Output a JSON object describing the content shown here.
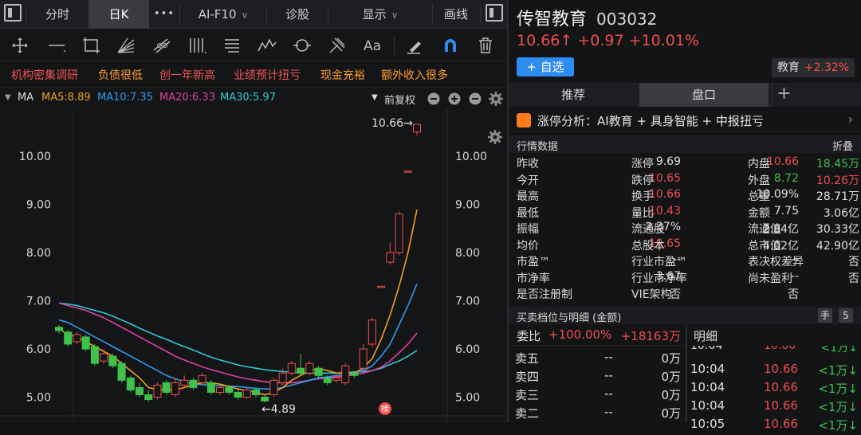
{
  "top_tabs": {
    "fenshi": "分时",
    "rik": "日K",
    "more": "•••",
    "aif10": "AI-F10",
    "zhengu": "诊股",
    "xianshi": "显示",
    "huaxian": "画线"
  },
  "tags": [
    "机构密集调研",
    "负债很低",
    "创一年新高",
    "业绩预计扭亏",
    "现金充裕",
    "额外收入很多"
  ],
  "ma": {
    "label": "MA",
    "ma5": "MA5:8.89",
    "ma10": "MA10:7.35",
    "ma20": "MA20:6.33",
    "ma30": "MA30:5.97",
    "fuquan": "前复权",
    "colors": {
      "ma5": "#f0a020",
      "ma10": "#2f9bf0",
      "ma20": "#e040a0",
      "ma30": "#30c8d8"
    }
  },
  "chart_data": {
    "type": "candlestick",
    "y_ticks": [
      "10.00",
      "9.00",
      "8.00",
      "7.00",
      "6.00",
      "5.00"
    ],
    "ylim": [
      4.7,
      10.9
    ],
    "high_annotation": "10.66→",
    "low_annotation": "←4.89",
    "badge": "榜",
    "candles": [
      {
        "o": 6.45,
        "c": 6.38,
        "h": 6.5,
        "l": 6.32
      },
      {
        "o": 6.35,
        "c": 6.1,
        "h": 6.4,
        "l": 6.05
      },
      {
        "o": 6.15,
        "c": 6.3,
        "h": 6.35,
        "l": 6.1
      },
      {
        "o": 6.25,
        "c": 6.0,
        "h": 6.3,
        "l": 5.95
      },
      {
        "o": 6.05,
        "c": 5.7,
        "h": 6.1,
        "l": 5.65
      },
      {
        "o": 5.75,
        "c": 5.9,
        "h": 6.0,
        "l": 5.7
      },
      {
        "o": 5.85,
        "c": 5.65,
        "h": 5.9,
        "l": 5.6
      },
      {
        "o": 5.7,
        "c": 5.35,
        "h": 5.75,
        "l": 5.3
      },
      {
        "o": 5.4,
        "c": 5.15,
        "h": 5.45,
        "l": 5.1
      },
      {
        "o": 5.2,
        "c": 5.05,
        "h": 5.3,
        "l": 5.0
      },
      {
        "o": 5.05,
        "c": 4.95,
        "h": 5.15,
        "l": 4.9
      },
      {
        "o": 5.0,
        "c": 5.25,
        "h": 5.3,
        "l": 4.95
      },
      {
        "o": 5.3,
        "c": 5.1,
        "h": 5.35,
        "l": 5.05
      },
      {
        "o": 5.05,
        "c": 5.3,
        "h": 5.4,
        "l": 5.0
      },
      {
        "o": 5.25,
        "c": 5.35,
        "h": 5.45,
        "l": 5.2
      },
      {
        "o": 5.35,
        "c": 5.2,
        "h": 5.4,
        "l": 5.15
      },
      {
        "o": 5.3,
        "c": 5.45,
        "h": 5.5,
        "l": 5.25
      },
      {
        "o": 5.3,
        "c": 5.1,
        "h": 5.35,
        "l": 5.05
      },
      {
        "o": 5.1,
        "c": 5.2,
        "h": 5.25,
        "l": 5.05
      },
      {
        "o": 5.2,
        "c": 5.1,
        "h": 5.25,
        "l": 5.05
      },
      {
        "o": 5.1,
        "c": 5.0,
        "h": 5.15,
        "l": 4.95
      },
      {
        "o": 5.0,
        "c": 5.15,
        "h": 5.2,
        "l": 4.97
      },
      {
        "o": 5.15,
        "c": 5.05,
        "h": 5.2,
        "l": 5.0
      },
      {
        "o": 5.0,
        "c": 4.92,
        "h": 5.05,
        "l": 4.89
      },
      {
        "o": 5.05,
        "c": 5.35,
        "h": 5.4,
        "l": 5.0
      },
      {
        "o": 5.3,
        "c": 5.5,
        "h": 5.6,
        "l": 5.25
      },
      {
        "o": 5.5,
        "c": 5.7,
        "h": 5.75,
        "l": 5.45
      },
      {
        "o": 5.6,
        "c": 5.5,
        "h": 5.9,
        "l": 5.45
      },
      {
        "o": 5.5,
        "c": 5.7,
        "h": 5.75,
        "l": 5.45
      },
      {
        "o": 5.6,
        "c": 5.45,
        "h": 5.65,
        "l": 5.4
      },
      {
        "o": 5.4,
        "c": 5.3,
        "h": 5.45,
        "l": 5.25
      },
      {
        "o": 5.35,
        "c": 5.4,
        "h": 5.45,
        "l": 5.3
      },
      {
        "o": 5.3,
        "c": 5.65,
        "h": 5.7,
        "l": 5.25
      },
      {
        "o": 5.5,
        "c": 5.45,
        "h": 5.55,
        "l": 5.4
      },
      {
        "o": 5.6,
        "c": 6.0,
        "h": 6.1,
        "l": 5.55
      },
      {
        "o": 6.1,
        "c": 6.6,
        "h": 6.65,
        "l": 6.05
      },
      {
        "o": 7.3,
        "c": 7.3,
        "h": 7.3,
        "l": 7.3
      },
      {
        "o": 7.8,
        "c": 8.0,
        "h": 8.2,
        "l": 7.75
      },
      {
        "o": 8.0,
        "c": 8.8,
        "h": 8.85,
        "l": 7.95
      },
      {
        "o": 9.69,
        "c": 9.69,
        "h": 9.69,
        "l": 9.69
      },
      {
        "o": 10.5,
        "c": 10.66,
        "h": 10.66,
        "l": 10.43
      }
    ],
    "ma5": [
      6.42,
      6.3,
      6.25,
      6.15,
      6.05,
      5.95,
      5.85,
      5.7,
      5.55,
      5.4,
      5.2,
      5.15,
      5.15,
      5.15,
      5.2,
      5.25,
      5.3,
      5.3,
      5.27,
      5.22,
      5.17,
      5.13,
      5.1,
      5.05,
      5.1,
      5.2,
      5.35,
      5.45,
      5.55,
      5.6,
      5.55,
      5.5,
      5.5,
      5.5,
      5.6,
      5.8,
      6.2,
      6.7,
      7.3,
      8.0,
      8.89
    ],
    "ma10": [
      6.6,
      6.55,
      6.45,
      6.35,
      6.25,
      6.15,
      6.05,
      5.95,
      5.85,
      5.75,
      5.65,
      5.55,
      5.45,
      5.38,
      5.32,
      5.28,
      5.26,
      5.25,
      5.24,
      5.23,
      5.22,
      5.2,
      5.18,
      5.17,
      5.17,
      5.2,
      5.25,
      5.3,
      5.35,
      5.4,
      5.42,
      5.45,
      5.47,
      5.5,
      5.55,
      5.65,
      5.85,
      6.1,
      6.5,
      6.9,
      7.35
    ],
    "ma20": [
      6.95,
      6.9,
      6.85,
      6.8,
      6.72,
      6.65,
      6.55,
      6.45,
      6.35,
      6.25,
      6.15,
      6.05,
      5.95,
      5.85,
      5.77,
      5.7,
      5.63,
      5.57,
      5.52,
      5.47,
      5.42,
      5.38,
      5.35,
      5.32,
      5.3,
      5.3,
      5.3,
      5.32,
      5.35,
      5.38,
      5.4,
      5.42,
      5.44,
      5.47,
      5.5,
      5.55,
      5.62,
      5.75,
      5.92,
      6.1,
      6.33
    ],
    "ma30": [
      6.95,
      6.93,
      6.9,
      6.85,
      6.8,
      6.75,
      6.68,
      6.6,
      6.52,
      6.43,
      6.35,
      6.27,
      6.2,
      6.12,
      6.05,
      5.98,
      5.9,
      5.83,
      5.77,
      5.72,
      5.67,
      5.63,
      5.6,
      5.57,
      5.55,
      5.53,
      5.52,
      5.5,
      5.5,
      5.5,
      5.5,
      5.5,
      5.51,
      5.52,
      5.53,
      5.55,
      5.6,
      5.68,
      5.75,
      5.85,
      5.97
    ]
  },
  "stock": {
    "name": "传智教育",
    "code": "003032",
    "price_line": "10.66↑  +0.97  +10.01%",
    "add_btn": "+ 自选",
    "sector_name": "教育",
    "sector_change": "+2.32%"
  },
  "right_tabs": {
    "tuijian": "推荐",
    "pankou": "盘口",
    "plus": "+"
  },
  "ztfx": "涨停分析：AI教育 + 具身智能 + 中报扭亏",
  "hq_header": {
    "title": "行情数据",
    "fold": "折叠"
  },
  "quote_rows": [
    [
      {
        "l": "昨收",
        "v": "9.69",
        "c": "white"
      },
      {
        "l": "涨停",
        "v": "10.66",
        "c": "red"
      },
      {
        "l": "内盘",
        "v": "18.45万",
        "c": "green"
      }
    ],
    [
      {
        "l": "今开",
        "v": "10.65",
        "c": "red"
      },
      {
        "l": "跌停",
        "v": "8.72",
        "c": "green"
      },
      {
        "l": "外盘",
        "v": "10.26万",
        "c": "red"
      }
    ],
    [
      {
        "l": "最高",
        "v": "10.66",
        "c": "red"
      },
      {
        "l": "换手",
        "v": "10.09%",
        "c": "white"
      },
      {
        "l": "总量",
        "v": "28.71万",
        "c": "white"
      }
    ],
    [
      {
        "l": "最低",
        "v": "10.43",
        "c": "red"
      },
      {
        "l": "量比",
        "v": "7.75",
        "c": "white"
      },
      {
        "l": "金额",
        "v": "3.06亿",
        "c": "white"
      }
    ],
    [
      {
        "l": "振幅",
        "v": "2.37%",
        "c": "white"
      },
      {
        "l": "流通股",
        "v": "2.84亿",
        "c": "white"
      },
      {
        "l": "流通值",
        "v": "30.33亿",
        "c": "white"
      }
    ],
    [
      {
        "l": "均价",
        "v": "10.65",
        "c": "red"
      },
      {
        "l": "总股本",
        "v": "4.02亿",
        "c": "white"
      },
      {
        "l": "总市值",
        "v": "42.90亿",
        "c": "white"
      }
    ],
    [
      {
        "l": "市盈™",
        "v": "--",
        "c": "white"
      },
      {
        "l": "行业市盈™",
        "v": "--",
        "c": "white"
      },
      {
        "l": "表决权差异",
        "v": "否",
        "c": "white"
      }
    ],
    [
      {
        "l": "市净率",
        "v": "3.67",
        "c": "white"
      },
      {
        "l": "行业市净率",
        "v": "--",
        "c": "white"
      },
      {
        "l": "尚未盈利",
        "v": "否",
        "c": "white"
      }
    ],
    [
      {
        "l": "是否注册制",
        "v": "否",
        "c": "white"
      },
      {
        "l": "VIE架构",
        "v": "否",
        "c": "white"
      },
      {
        "l": "",
        "v": "",
        "c": "white"
      }
    ]
  ],
  "mm_header": {
    "title": "买卖档位与明细 (金额)",
    "hand": "手",
    "five": "5"
  },
  "weibi": {
    "label": "委比",
    "pct": "+100.00%",
    "amt": "+18163万"
  },
  "mingxi": "明细",
  "orders": [
    {
      "l": "卖五",
      "p": "--",
      "v": "0万"
    },
    {
      "l": "卖四",
      "p": "--",
      "v": "0万"
    },
    {
      "l": "卖三",
      "p": "--",
      "v": "0万"
    },
    {
      "l": "卖二",
      "p": "--",
      "v": "0万"
    }
  ],
  "trades": [
    {
      "t": "10:04",
      "p": "10.66",
      "v": "<1万↓"
    },
    {
      "t": "10:04",
      "p": "10.66",
      "v": "<1万↓"
    },
    {
      "t": "10:04",
      "p": "10.66",
      "v": "<1万↓"
    },
    {
      "t": "10:05",
      "p": "10.66",
      "v": "<1万↓"
    }
  ]
}
